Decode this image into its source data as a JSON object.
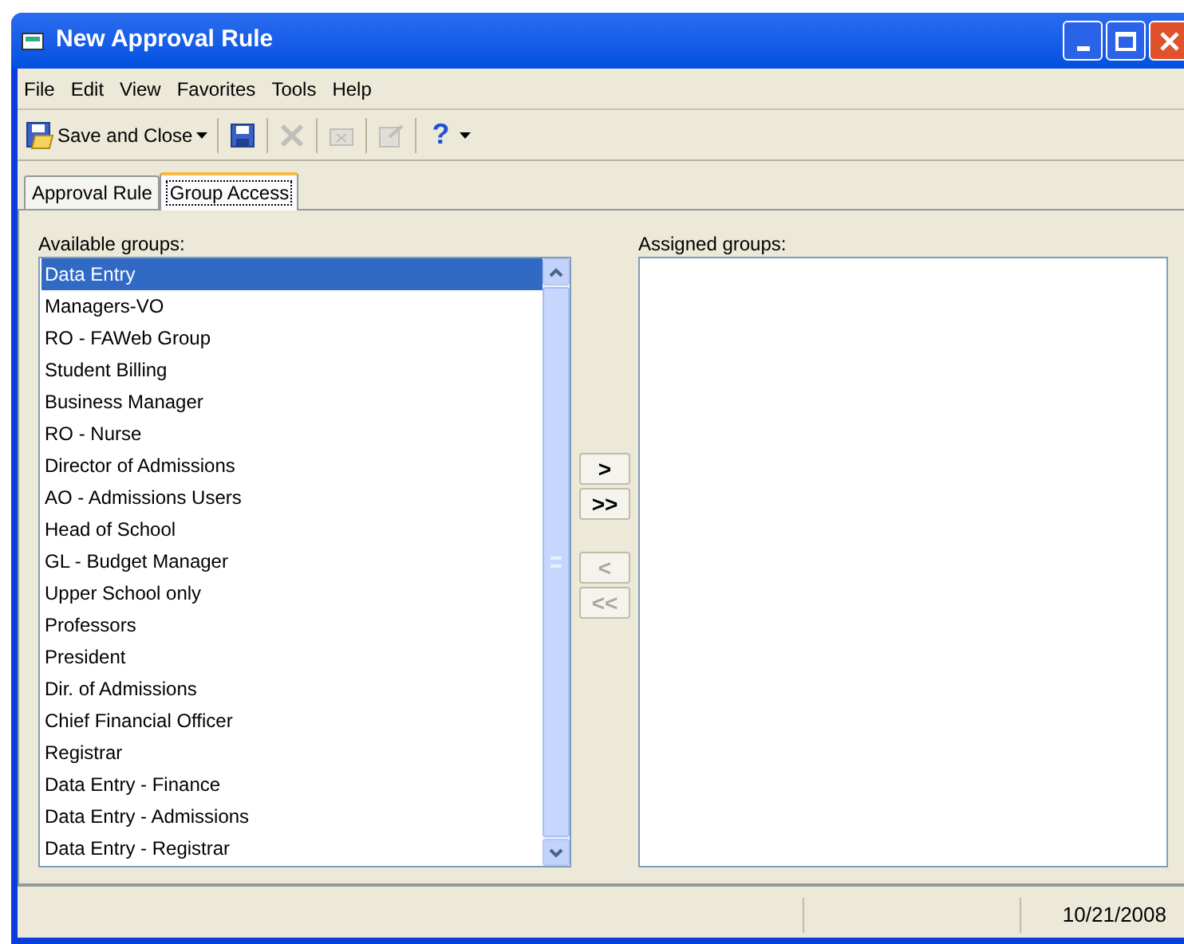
{
  "window": {
    "title": "New Approval Rule"
  },
  "menu": [
    {
      "label": "File"
    },
    {
      "label": "Edit"
    },
    {
      "label": "View"
    },
    {
      "label": "Favorites"
    },
    {
      "label": "Tools"
    },
    {
      "label": "Help"
    }
  ],
  "toolbar": [
    {
      "kind": "save-close",
      "label": "Save and Close",
      "disabled": false
    },
    {
      "kind": "save",
      "disabled": false
    },
    {
      "kind": "delete",
      "disabled": true
    },
    {
      "kind": "folder",
      "disabled": true
    },
    {
      "kind": "properties",
      "disabled": true
    },
    {
      "kind": "help",
      "label": "?",
      "disabled": false
    }
  ],
  "tabs": [
    {
      "label": "Approval Rule",
      "selected": false
    },
    {
      "label": "Group Access",
      "selected": true
    }
  ],
  "available": {
    "label": "Available groups:",
    "items": [
      {
        "label": "Data Entry",
        "selected": true
      },
      {
        "label": "Managers-VO",
        "selected": false
      },
      {
        "label": "RO - FAWeb Group",
        "selected": false
      },
      {
        "label": "Student Billing",
        "selected": false
      },
      {
        "label": "Business Manager",
        "selected": false
      },
      {
        "label": "RO - Nurse",
        "selected": false
      },
      {
        "label": "Director of Admissions",
        "selected": false
      },
      {
        "label": "AO - Admissions Users",
        "selected": false
      },
      {
        "label": "Head of School",
        "selected": false
      },
      {
        "label": "GL - Budget Manager",
        "selected": false
      },
      {
        "label": "Upper School only",
        "selected": false
      },
      {
        "label": "Professors",
        "selected": false
      },
      {
        "label": "President",
        "selected": false
      },
      {
        "label": "Dir. of Admissions",
        "selected": false
      },
      {
        "label": "Chief Financial Officer",
        "selected": false
      },
      {
        "label": "Registrar",
        "selected": false
      },
      {
        "label": "Data Entry - Finance",
        "selected": false
      },
      {
        "label": "Data Entry - Admissions",
        "selected": false
      },
      {
        "label": "Data Entry - Registrar",
        "selected": false
      }
    ]
  },
  "move_buttons": [
    {
      "label": ">",
      "disabled": false
    },
    {
      "label": ">>",
      "disabled": false
    },
    {
      "label": "<",
      "disabled": true
    },
    {
      "label": "<<",
      "disabled": true
    }
  ],
  "assigned": {
    "label": "Assigned groups:"
  },
  "status_bar": {
    "date": "10/21/2008"
  }
}
